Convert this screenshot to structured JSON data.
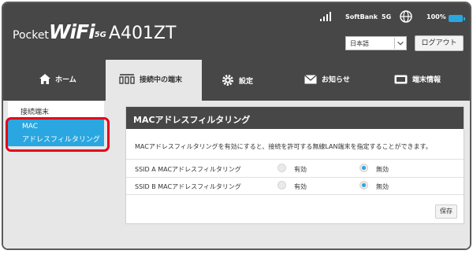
{
  "header": {
    "brand_pocket": "Pocket",
    "brand_wifi": "WiFi",
    "brand_5g": "5G",
    "brand_model": "A401ZT",
    "carrier": "SoftBank",
    "network": "5G",
    "battery": "100%",
    "language": "日本語",
    "logout_label": "ログアウト",
    "accent_color": "#2aa7e0"
  },
  "nav": {
    "tabs": [
      {
        "label": "ホーム",
        "icon": "home-icon"
      },
      {
        "label": "接続中の端末",
        "icon": "devices-icon"
      },
      {
        "label": "設定",
        "icon": "gear-icon"
      },
      {
        "label": "お知らせ",
        "icon": "envelope-icon"
      },
      {
        "label": "端末情報",
        "icon": "monitor-icon"
      }
    ],
    "active_tab": "接続中の端末"
  },
  "sidebar": {
    "items": [
      {
        "label": "接続端末"
      },
      {
        "label_line1": "MAC",
        "label_line2": "アドレスフィルタリング"
      }
    ],
    "highlight_color": "#e5001e"
  },
  "main": {
    "title": "MACアドレスフィルタリング",
    "description": "MACアドレスフィルタリングを有効にすると、接続を許可する無線LAN端末を指定することができます。",
    "rows": [
      {
        "label": "SSID A MACアドレスフィルタリング",
        "option_enable": "有効",
        "option_disable": "無効",
        "selected": "無効"
      },
      {
        "label": "SSID B MACアドレスフィルタリング",
        "option_enable": "有効",
        "option_disable": "無効",
        "selected": "無効"
      }
    ],
    "save_label": "保存"
  }
}
